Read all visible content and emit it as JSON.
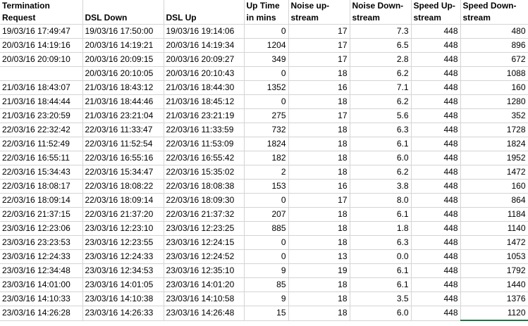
{
  "headers": [
    {
      "line1": "Termination",
      "line2": "Request"
    },
    {
      "line1": "",
      "line2": "DSL Down"
    },
    {
      "line1": "",
      "line2": "DSL Up"
    },
    {
      "line1": "Up Time",
      "line2": "in mins"
    },
    {
      "line1": "Noise up-",
      "line2": "stream"
    },
    {
      "line1": "Noise Down-",
      "line2": "stream"
    },
    {
      "line1": "Speed Up-",
      "line2": "stream"
    },
    {
      "line1": "Speed Down-",
      "line2": "stream"
    }
  ],
  "rows": [
    [
      "19/03/16 17:49:47",
      "19/03/16 17:50:00",
      "19/03/16 19:14:06",
      "0",
      "17",
      "7.3",
      "448",
      "480"
    ],
    [
      "20/03/16 14:19:16",
      "20/03/16 14:19:21",
      "20/03/16 14:19:34",
      "1204",
      "17",
      "6.5",
      "448",
      "896"
    ],
    [
      "20/03/16 20:09:10",
      "20/03/16 20:09:15",
      "20/03/16 20:09:27",
      "349",
      "17",
      "2.8",
      "448",
      "672"
    ],
    [
      "",
      "20/03/16 20:10:05",
      "20/03/16 20:10:43",
      "0",
      "18",
      "6.2",
      "448",
      "1088"
    ],
    [
      "21/03/16 18:43:07",
      "21/03/16 18:43:12",
      "21/03/16 18:44:30",
      "1352",
      "16",
      "7.1",
      "448",
      "160"
    ],
    [
      "21/03/16 18:44:44",
      "21/03/16 18:44:46",
      "21/03/16 18:45:12",
      "0",
      "18",
      "6.2",
      "448",
      "1280"
    ],
    [
      "21/03/16 23:20:59",
      "21/03/16 23:21:04",
      "21/03/16 23:21:19",
      "275",
      "17",
      "5.6",
      "448",
      "352"
    ],
    [
      "22/03/16 22:32:42",
      "22/03/16 11:33:47",
      "22/03/16 11:33:59",
      "732",
      "18",
      "6.3",
      "448",
      "1728"
    ],
    [
      "22/03/16 11:52:49",
      "22/03/16 11:52:54",
      "22/03/16 11:53:09",
      "1824",
      "18",
      "6.1",
      "448",
      "1824"
    ],
    [
      "22/03/16 16:55:11",
      "22/03/16 16:55:16",
      "22/03/16 16:55:42",
      "182",
      "18",
      "6.0",
      "448",
      "1952"
    ],
    [
      "22/03/16 15:34:43",
      "22/03/16 15:34:47",
      "22/03/16 15:35:02",
      "2",
      "18",
      "6.2",
      "448",
      "1472"
    ],
    [
      "22/03/16 18:08:17",
      "22/03/16 18:08:22",
      "22/03/16 18:08:38",
      "153",
      "16",
      "3.8",
      "448",
      "160"
    ],
    [
      "22/03/16 18:09:14",
      "22/03/16 18:09:14",
      "22/03/16 18:09:30",
      "0",
      "17",
      "8.0",
      "448",
      "864"
    ],
    [
      "22/03/16 21:37:15",
      "22/03/16 21:37:20",
      "22/03/16 21:37:32",
      "207",
      "18",
      "6.1",
      "448",
      "1184"
    ],
    [
      "23/03/16 12:23:06",
      "23/03/16 12:23:10",
      "23/03/16 12:23:25",
      "885",
      "18",
      "1.8",
      "448",
      "1140"
    ],
    [
      "23/03/16 23:23:53",
      "23/03/16 12:23:55",
      "23/03/16 12:24:15",
      "0",
      "18",
      "6.3",
      "448",
      "1472"
    ],
    [
      "23/03/16 12:24:33",
      "23/03/16 12:24:33",
      "23/03/16 12:24:52",
      "0",
      "13",
      "0.0",
      "448",
      "1053"
    ],
    [
      "23/03/16 12:34:48",
      "23/03/16 12:34:53",
      "23/03/16 12:35:10",
      "9",
      "19",
      "6.1",
      "448",
      "1792"
    ],
    [
      "23/03/16 14:01:00",
      "23/03/16 14:01:05",
      "23/03/16 14:01:20",
      "85",
      "18",
      "6.1",
      "448",
      "1440"
    ],
    [
      "23/03/16 14:10:33",
      "23/03/16 14:10:38",
      "23/03/16 14:10:58",
      "9",
      "18",
      "3.5",
      "448",
      "1376"
    ],
    [
      "23/03/16 14:26:28",
      "23/03/16 14:26:33",
      "23/03/16 14:26:48",
      "15",
      "18",
      "6.0",
      "448",
      "1120"
    ]
  ],
  "colors": {
    "gridline": "#d4d4d4",
    "selection": "#217346"
  }
}
